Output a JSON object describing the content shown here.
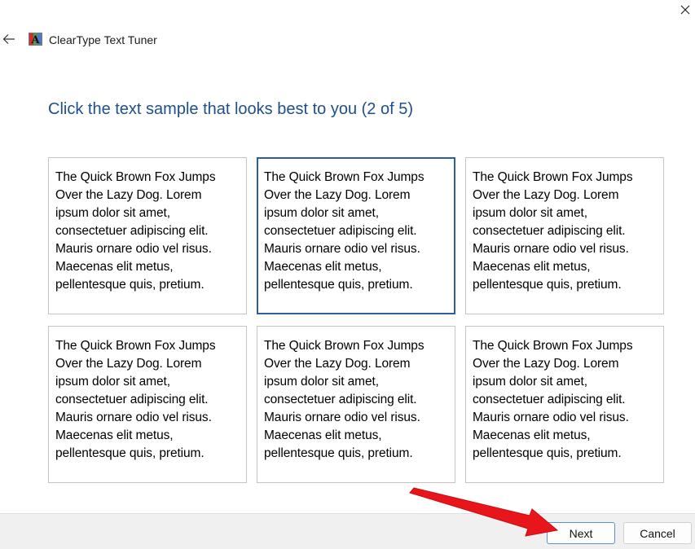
{
  "window": {
    "title": "ClearType Text Tuner"
  },
  "main": {
    "heading": "Click the text sample that looks best to you (2 of 5)",
    "selected_index": 1,
    "samples": [
      {
        "text": "The Quick Brown Fox Jumps\nOver the Lazy Dog. Lorem\nipsum dolor sit amet,\nconsectetuer adipiscing elit.\nMauris ornare odio vel risus.\nMaecenas elit metus,\npellentesque quis, pretium."
      },
      {
        "text": "The Quick Brown Fox Jumps\nOver the Lazy Dog. Lorem\nipsum dolor sit amet,\nconsectetuer adipiscing elit.\nMauris ornare odio vel risus.\nMaecenas elit metus,\npellentesque quis, pretium."
      },
      {
        "text": "The Quick Brown Fox Jumps\nOver the Lazy Dog. Lorem\nipsum dolor sit amet,\nconsectetuer adipiscing elit.\nMauris ornare odio vel risus.\nMaecenas elit metus,\npellentesque quis, pretium."
      },
      {
        "text": "The Quick Brown Fox Jumps\nOver the Lazy Dog. Lorem\nipsum dolor sit amet,\nconsectetuer adipiscing elit.\nMauris ornare odio vel risus.\nMaecenas elit metus,\npellentesque quis, pretium."
      },
      {
        "text": "The Quick Brown Fox Jumps\nOver the Lazy Dog. Lorem\nipsum dolor sit amet,\nconsectetuer adipiscing elit.\nMauris ornare odio vel risus.\nMaecenas elit metus,\npellentesque quis, pretium."
      },
      {
        "text": "The Quick Brown Fox Jumps\nOver the Lazy Dog. Lorem\nipsum dolor sit amet,\nconsectetuer adipiscing elit.\nMauris ornare odio vel risus.\nMaecenas elit metus,\npellentesque quis, pretium."
      }
    ]
  },
  "footer": {
    "next_label": "Next",
    "cancel_label": "Cancel"
  },
  "colors": {
    "heading": "#1f4e8c",
    "selected_border": "#2b5f9e",
    "annotation_arrow": "#e8161b"
  },
  "icons": {
    "back": "back-arrow-icon",
    "app": "cleartype-app-icon",
    "close": "close-icon"
  }
}
